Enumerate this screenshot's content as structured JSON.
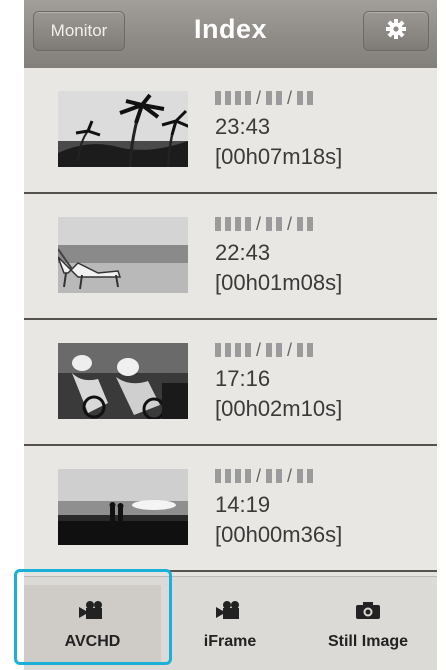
{
  "header": {
    "monitor_label": "Monitor",
    "title": "Index",
    "settings_icon": "gear-icon"
  },
  "files": [
    {
      "date": "▮▮▮▮/▮▮/▮▮",
      "time": "23:43",
      "duration": "[00h07m18s]",
      "thumbnail": "palm-trees"
    },
    {
      "date": "▮▮▮▮/▮▮/▮▮",
      "time": "22:43",
      "duration": "[00h01m08s]",
      "thumbnail": "beach-chair"
    },
    {
      "date": "▮▮▮▮/▮▮/▮▮",
      "time": "17:16",
      "duration": "[00h02m10s]",
      "thumbnail": "cyclists"
    },
    {
      "date": "▮▮▮▮/▮▮/▮▮",
      "time": "14:19",
      "duration": "[00h00m36s]",
      "thumbnail": "couple-sunset"
    }
  ],
  "tabs": [
    {
      "label": "AVCHD",
      "icon": "movie-camera-icon",
      "selected": true
    },
    {
      "label": "iFrame",
      "icon": "movie-camera-icon",
      "selected": false
    },
    {
      "label": "Still Image",
      "icon": "camera-icon",
      "selected": false
    }
  ],
  "colors": {
    "highlight": "#1ab0d8",
    "header": "#8f8b87"
  }
}
